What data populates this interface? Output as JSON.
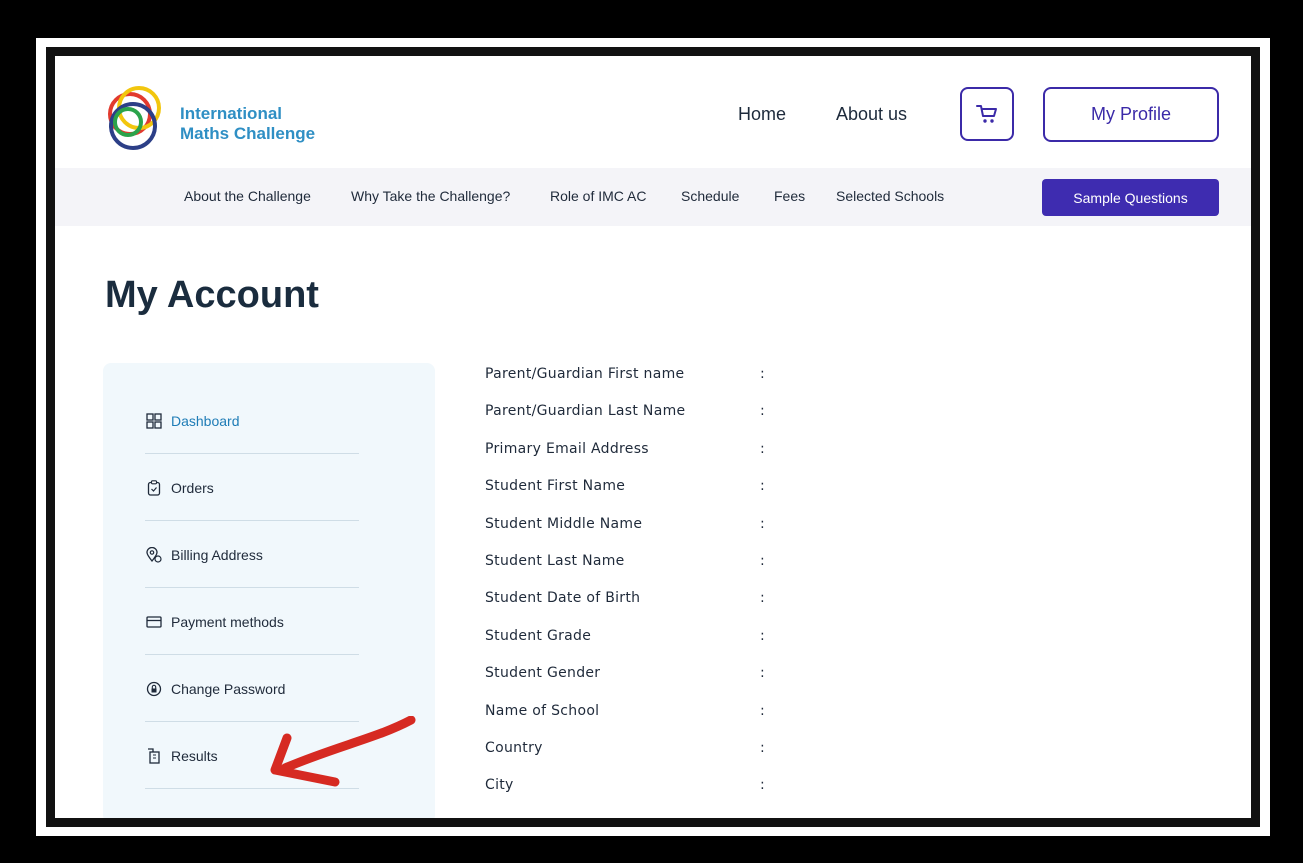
{
  "brand": {
    "line1": "International",
    "line2": "Maths Challenge"
  },
  "topnav": {
    "home": "Home",
    "about": "About us",
    "profile": "My Profile"
  },
  "subnav": {
    "items": [
      "About the Challenge",
      "Why Take the Challenge?",
      "Role of IMC AC",
      "Schedule",
      "Fees",
      "Selected Schools"
    ],
    "sample": "Sample Questions"
  },
  "page": {
    "title": "My Account"
  },
  "sidebar": {
    "items": [
      {
        "label": "Dashboard",
        "icon": "dashboard-icon"
      },
      {
        "label": "Orders",
        "icon": "clipboard-icon"
      },
      {
        "label": "Billing Address",
        "icon": "location-icon"
      },
      {
        "label": "Payment methods",
        "icon": "card-icon"
      },
      {
        "label": "Change Password",
        "icon": "lock-icon"
      },
      {
        "label": "Results",
        "icon": "results-icon"
      }
    ]
  },
  "fields": [
    "Parent/Guardian First name",
    "Parent/Guardian Last Name",
    "Primary Email Address",
    "Student First Name",
    "Student Middle Name",
    "Student Last Name",
    "Student Date of Birth",
    "Student Grade",
    "Student Gender",
    "Name of School",
    "Country",
    "City"
  ],
  "separator": ":",
  "colors": {
    "accent": "#3e2cb0",
    "brand": "#2f8fc4",
    "arrow": "#d62a22"
  }
}
